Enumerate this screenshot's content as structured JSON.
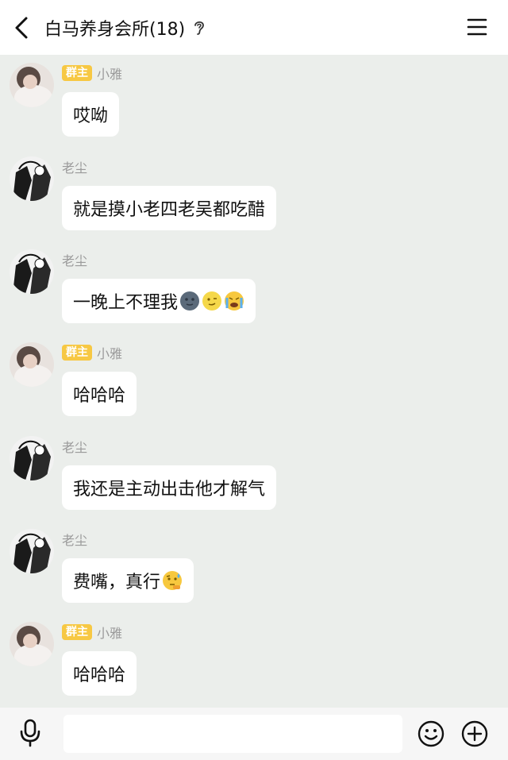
{
  "header": {
    "title": "白马养身会所(18)"
  },
  "messages": [
    {
      "sender": "小雅",
      "badge": "群主",
      "text": "哎呦",
      "emojis": []
    },
    {
      "sender": "老尘",
      "badge": "",
      "text": "就是摸小老四老吴都吃醋",
      "emojis": []
    },
    {
      "sender": "老尘",
      "badge": "",
      "text": "一晚上不理我",
      "emojis": [
        "new-moon-face-emoji",
        "moon-face-emoji",
        "crying-face-emoji"
      ]
    },
    {
      "sender": "小雅",
      "badge": "群主",
      "text": "哈哈哈",
      "emojis": []
    },
    {
      "sender": "老尘",
      "badge": "",
      "text": "我还是主动出击他才解气",
      "emojis": []
    },
    {
      "sender": "老尘",
      "badge": "",
      "text": "费嘴，真行",
      "emojis": [
        "sweat-thinking-face-emoji"
      ]
    },
    {
      "sender": "小雅",
      "badge": "群主",
      "text": "哈哈哈",
      "emojis": []
    }
  ],
  "composer": {
    "placeholder": ""
  },
  "colors": {
    "badge": "#f7c843",
    "background": "#ebeeeb",
    "bubble": "#ffffff"
  }
}
